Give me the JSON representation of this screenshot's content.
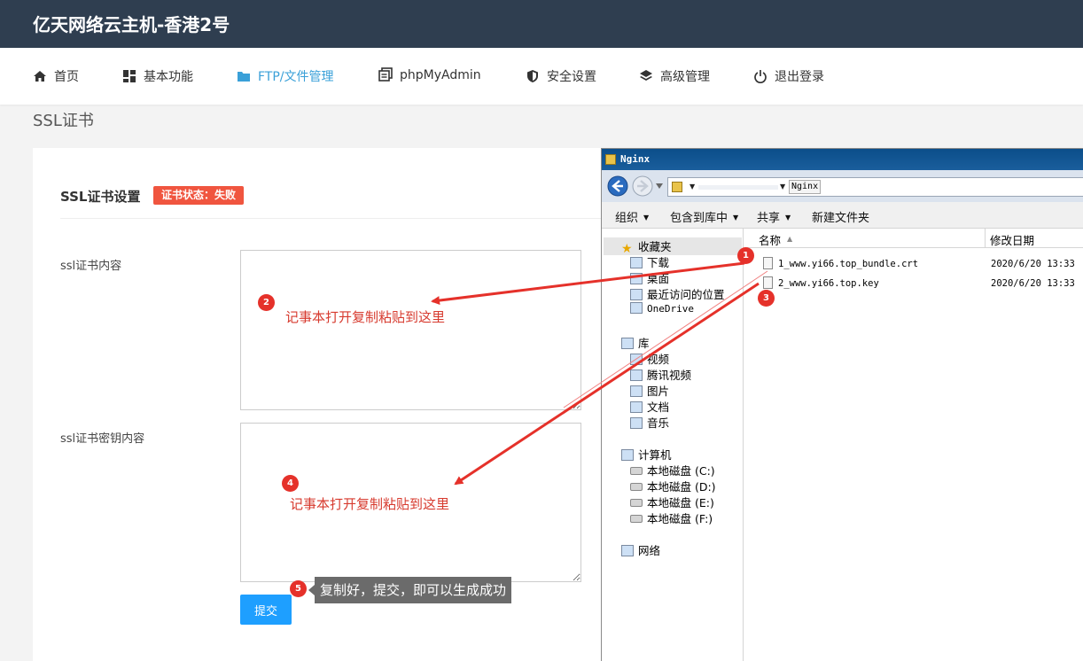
{
  "header": {
    "title": "亿天网络云主机-香港2号"
  },
  "nav": {
    "items": [
      {
        "label": "首页",
        "icon": "home-icon"
      },
      {
        "label": "基本功能",
        "icon": "grid-icon"
      },
      {
        "label": "FTP/文件管理",
        "icon": "folder-icon"
      },
      {
        "label": "phpMyAdmin",
        "icon": "database-icon"
      },
      {
        "label": "安全设置",
        "icon": "shield-icon"
      },
      {
        "label": "高级管理",
        "icon": "layers-icon"
      },
      {
        "label": "退出登录",
        "icon": "power-icon"
      }
    ],
    "active_color": "#3aa0d8"
  },
  "page": {
    "title": "SSL证书"
  },
  "card": {
    "title": "SSL证书设置",
    "badge": "证书状态：失败",
    "badge_color": "#f0553f",
    "cert_label": "ssl证书内容",
    "key_label": "ssl证书密钥内容",
    "cert_value": "",
    "key_value": "",
    "submit_label": "提交",
    "submit_color": "#1e9fff"
  },
  "annotations": {
    "step1": "1",
    "step2": "2",
    "step3": "3",
    "step4": "4",
    "step5": "5",
    "text2": "记事本打开复制粘贴到这里",
    "text4": "记事本打开复制粘贴到这里",
    "tip5": "复制好，提交，即可以生成成功",
    "color": "#d73a2e"
  },
  "explorer": {
    "window_title": "Nginx",
    "breadcrumb": "Nginx",
    "toolbar": [
      "组织",
      "包含到库中",
      "共享",
      "新建文件夹"
    ],
    "favorites": {
      "label": "收藏夹",
      "items": [
        "下载",
        "桌面",
        "最近访问的位置",
        "OneDrive"
      ]
    },
    "libraries": {
      "label": "库",
      "items": [
        "视频",
        "腾讯视频",
        "图片",
        "文档",
        "音乐"
      ]
    },
    "computer": {
      "label": "计算机",
      "items": [
        "本地磁盘 (C:)",
        "本地磁盘 (D:)",
        "本地磁盘 (E:)",
        "本地磁盘 (F:)"
      ]
    },
    "network": {
      "label": "网络"
    },
    "columns": {
      "name": "名称",
      "date": "修改日期"
    },
    "files": [
      {
        "name": "1_www.yi66.top_bundle.crt",
        "date": "2020/6/20 13:33"
      },
      {
        "name": "2_www.yi66.top.key",
        "date": "2020/6/20 13:33"
      }
    ]
  }
}
